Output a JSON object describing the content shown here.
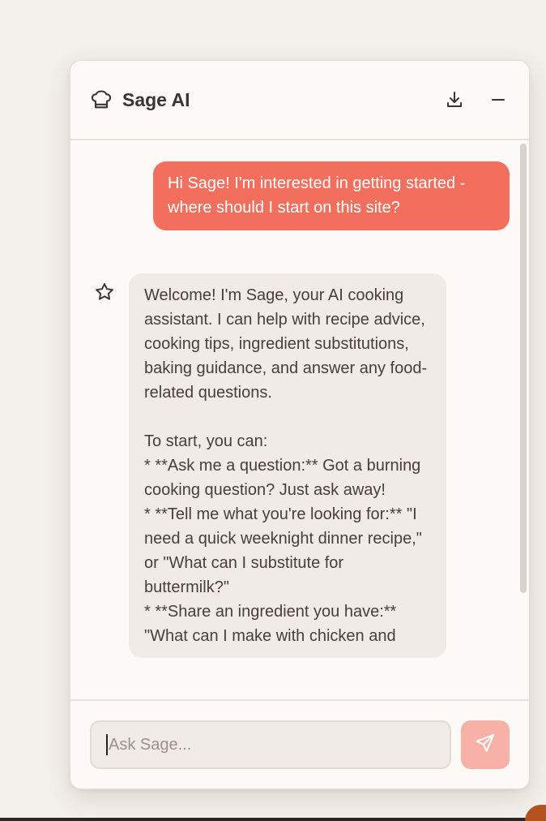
{
  "header": {
    "title": "Sage AI",
    "logo_icon": "chef-hat-icon",
    "actions": [
      {
        "icon": "download-icon"
      },
      {
        "icon": "minimize-icon"
      }
    ]
  },
  "messages": {
    "user": {
      "text": "Hi Sage! I'm interested in getting started - where should I start on this site?"
    },
    "assistant": {
      "icon": "star-icon",
      "lines": [
        "Welcome! I'm Sage, your AI cooking assistant. I can help with recipe advice, cooking tips, ingredient substitutions, baking guidance, and answer any food-related questions.",
        "",
        "To start, you can:",
        "* **Ask me a question:** Got a burning cooking question? Just ask away!",
        "* **Tell me what you're looking for:** \"I need a quick weeknight dinner recipe,\" or \"What can I substitute for buttermilk?\"",
        "* **Share an ingredient you have:** \"What can I make with chicken and"
      ]
    }
  },
  "composer": {
    "placeholder": "Ask Sage...",
    "send_icon": "send-icon"
  },
  "colors": {
    "user_bubble": "#f16f5c",
    "assistant_bubble": "#f0ebe6",
    "send_button": "#f8b1a6",
    "window_bg": "#fcf9f7",
    "page_bg": "#f3efea"
  }
}
